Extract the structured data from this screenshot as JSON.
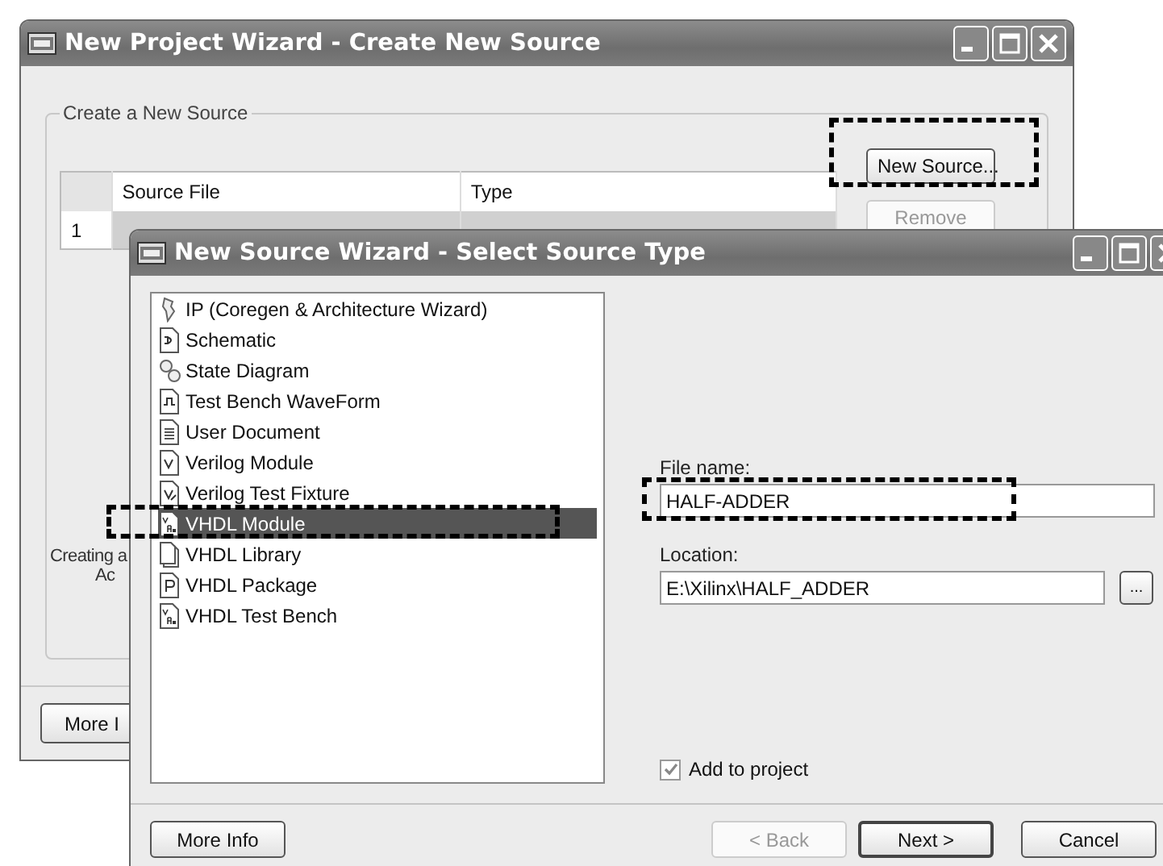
{
  "back_window": {
    "title": "New Project Wizard - Create New Source",
    "group": {
      "title": "Create a New Source"
    },
    "table": {
      "columns": [
        "Source File",
        "Type"
      ],
      "rows": [
        {
          "number": "1"
        }
      ]
    },
    "buttons": [
      {
        "label": "New Source...",
        "disabled": false
      },
      {
        "label": "Remove",
        "disabled": true
      }
    ],
    "note_lines": [
      "Creating a",
      "Ac"
    ],
    "more_info_button": "More I"
  },
  "front_window": {
    "title": "New Source Wizard - Select Source Type",
    "source_types": [
      {
        "label": "IP (Coregen & Architecture Wizard)",
        "selected": false
      },
      {
        "label": "Schematic",
        "selected": false
      },
      {
        "label": "State Diagram",
        "selected": false
      },
      {
        "label": "Test Bench WaveForm",
        "selected": false
      },
      {
        "label": "User Document",
        "selected": false
      },
      {
        "label": "Verilog Module",
        "selected": false
      },
      {
        "label": "Verilog Test Fixture",
        "selected": false
      },
      {
        "label": "VHDL Module",
        "selected": true
      },
      {
        "label": "VHDL Library",
        "selected": false
      },
      {
        "label": "VHDL Package",
        "selected": false
      },
      {
        "label": "VHDL Test Bench",
        "selected": false
      }
    ],
    "file_name": {
      "label": "File name:",
      "value": "HALF-ADDER"
    },
    "location": {
      "label": "Location:",
      "value": "E:\\Xilinx\\HALF_ADDER",
      "browse": "..."
    },
    "add_to_project": {
      "label": "Add to project",
      "checked": true
    },
    "buttons": [
      {
        "label": "More Info",
        "disabled": false
      },
      {
        "label": "< Back",
        "disabled": true
      },
      {
        "label": "Next >",
        "disabled": false,
        "default": true
      },
      {
        "label": "Cancel",
        "disabled": false
      }
    ]
  }
}
